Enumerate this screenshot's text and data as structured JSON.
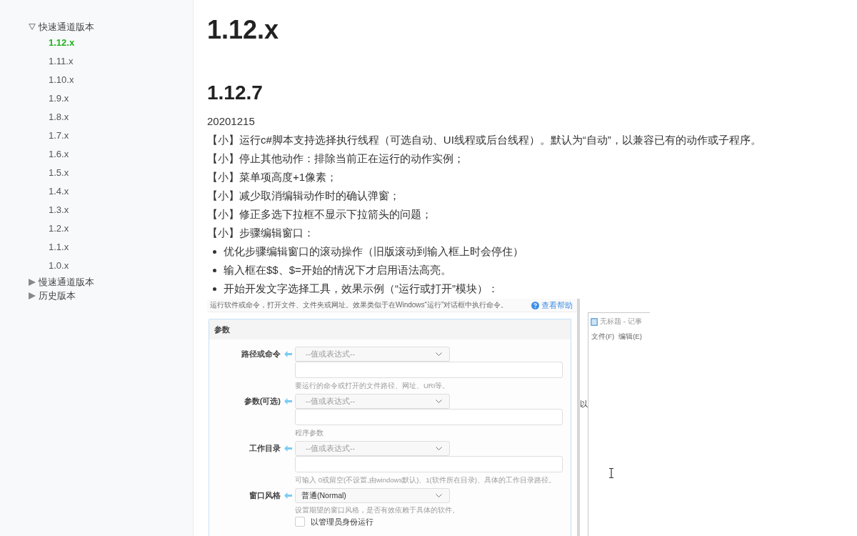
{
  "sidebar": {
    "groups": [
      {
        "label": "快速通道版本",
        "expanded": true,
        "children": [
          {
            "label": "1.12.x",
            "selected": true
          },
          {
            "label": "1.11.x",
            "selected": false
          },
          {
            "label": "1.10.x",
            "selected": false
          },
          {
            "label": "1.9.x",
            "selected": false
          },
          {
            "label": "1.8.x",
            "selected": false
          },
          {
            "label": "1.7.x",
            "selected": false
          },
          {
            "label": "1.6.x",
            "selected": false
          },
          {
            "label": "1.5.x",
            "selected": false
          },
          {
            "label": "1.4.x",
            "selected": false
          },
          {
            "label": "1.3.x",
            "selected": false
          },
          {
            "label": "1.2.x",
            "selected": false
          },
          {
            "label": "1.1.x",
            "selected": false
          },
          {
            "label": "1.0.x",
            "selected": false
          }
        ]
      },
      {
        "label": "慢速通道版本",
        "expanded": false
      },
      {
        "label": "历史版本",
        "expanded": false
      }
    ]
  },
  "article": {
    "title": "1.12.x",
    "heading": "1.12.7",
    "date": "20201215",
    "items": [
      {
        "kind": "line",
        "text": "【小】运行c#脚本支持选择执行线程（可选自动、UI线程或后台线程）。默认为“自动”，以兼容已有的动作或子程序。"
      },
      {
        "kind": "line",
        "text": "【小】停止其他动作：排除当前正在运行的动作实例；"
      },
      {
        "kind": "line",
        "text": "【小】菜单项高度+1像素；"
      },
      {
        "kind": "line",
        "text": "【小】减少取消编辑动作时的确认弹窗；"
      },
      {
        "kind": "line",
        "text": "【小】修正多选下拉框不显示下拉箭头的问题；"
      },
      {
        "kind": "line",
        "text": "【小】步骤编辑窗口："
      },
      {
        "kind": "bullet",
        "text": "优化步骤编辑窗口的滚动操作（旧版滚动到输入框上时会停住）"
      },
      {
        "kind": "bullet",
        "text": "输入框在$$、$=开始的情况下才启用语法高亮。"
      },
      {
        "kind": "bullet",
        "text": "开始开发文字选择工具，效果示例（“运行或打开”模块）："
      }
    ]
  },
  "figure": {
    "description": "运行软件或命令，打开文件、文件夹或网址。效果类似于在Windows“运行”对话框中执行命令。",
    "help_link": "查看帮助",
    "panel_title": "参数",
    "fields": [
      {
        "kind": "expression",
        "label": "路径或命令",
        "placeholder": "--值或表达式--",
        "hint": "要运行的命令或打开的文件路径、网址、URI等。"
      },
      {
        "kind": "expression",
        "label": "参数(可选)",
        "placeholder": "--值或表达式--",
        "hint": "程序参数"
      },
      {
        "kind": "expression",
        "label": "工作目录",
        "placeholder": "--值或表达式--",
        "hint": "可输入 0或留空(不设置,由windows默认)、1(软件所在目录)、具体的工作目录路径。"
      },
      {
        "kind": "select",
        "label": "窗口风格",
        "value": "普通(Normal)",
        "hint": "设置期望的窗口风格，是否有效依赖于具体的软件。"
      },
      {
        "kind": "checkbox",
        "label": "以管理员身份运行",
        "checked": false
      }
    ],
    "hidden_text": "以",
    "notepad": {
      "title": "无标题 - 记事",
      "menu": [
        "文件(F)",
        "编辑(E)"
      ]
    }
  }
}
